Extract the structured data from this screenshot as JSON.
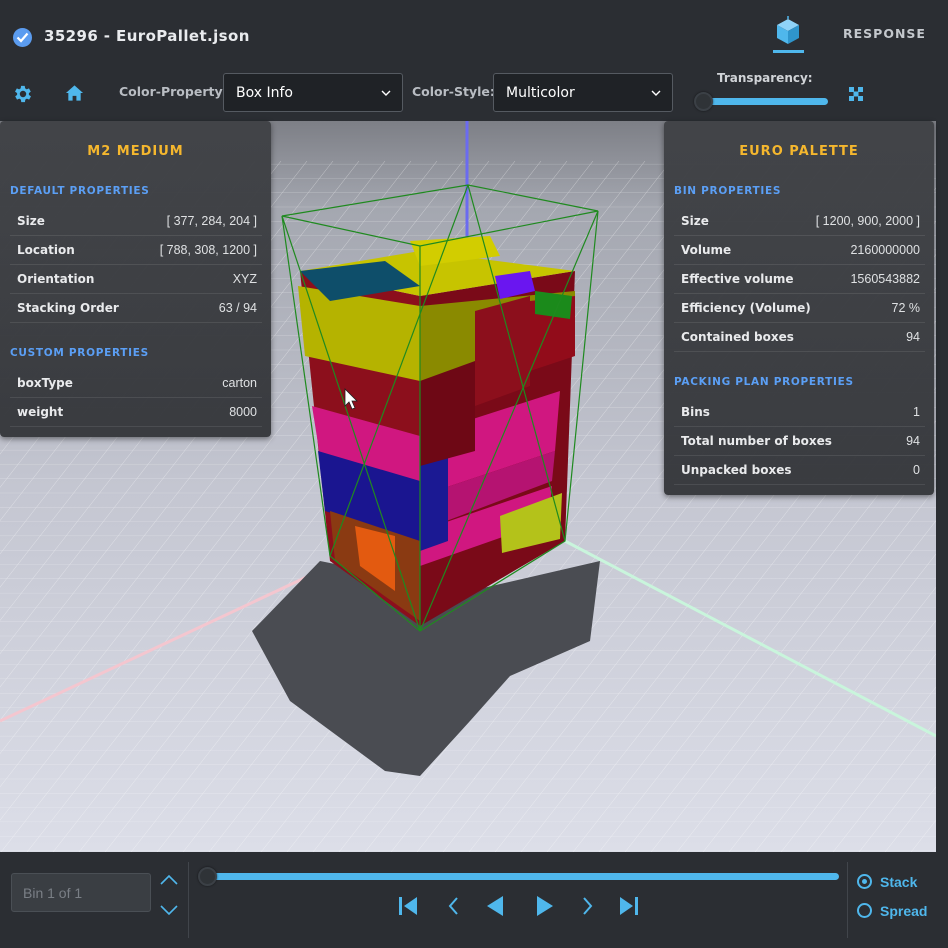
{
  "header": {
    "title": "35296 - EuroPallet.json",
    "response_tab": "RESPONSE",
    "view_tab_icon": "cube-view-icon"
  },
  "toolbar": {
    "color_property_label": "Color-Property:",
    "color_property_value": "Box Info",
    "color_style_label": "Color-Style:",
    "color_style_value": "Multicolor",
    "transparency_label": "Transparency:",
    "transparency_value": 0
  },
  "box_panel": {
    "title": "M2 MEDIUM",
    "default_section": "DEFAULT PROPERTIES",
    "default_rows": [
      {
        "key": "Size",
        "value": "[ 377, 284, 204 ]"
      },
      {
        "key": "Location",
        "value": "[ 788, 308, 1200 ]"
      },
      {
        "key": "Orientation",
        "value": "XYZ"
      },
      {
        "key": "Stacking Order",
        "value": "63 / 94"
      }
    ],
    "custom_section": "CUSTOM PROPERTIES",
    "custom_rows": [
      {
        "key": "boxType",
        "value": "carton"
      },
      {
        "key": "weight",
        "value": "8000"
      }
    ]
  },
  "bin_panel": {
    "title": "EURO PALETTE",
    "bin_section": "BIN PROPERTIES",
    "bin_rows": [
      {
        "key": "Size",
        "value": "[ 1200, 900, 2000 ]"
      },
      {
        "key": "Volume",
        "value": "2160000000"
      },
      {
        "key": "Effective volume",
        "value": "1560543882"
      },
      {
        "key": "Efficiency (Volume)",
        "value": "72 %"
      },
      {
        "key": "Contained boxes",
        "value": "94"
      }
    ],
    "plan_section": "PACKING PLAN PROPERTIES",
    "plan_rows": [
      {
        "key": "Bins",
        "value": "1"
      },
      {
        "key": "Total number of boxes",
        "value": "94"
      },
      {
        "key": "Unpacked boxes",
        "value": "0"
      }
    ]
  },
  "footer": {
    "bin_placeholder": "Bin 1 of 1",
    "timeline_value": 0,
    "mode_options": [
      "Stack",
      "Spread"
    ],
    "mode_selected": "Stack"
  },
  "colors": {
    "accent": "#4fb7ec",
    "panel_title": "#f5b72e",
    "section_title": "#5b9ff5",
    "background": "#2b2e33"
  }
}
